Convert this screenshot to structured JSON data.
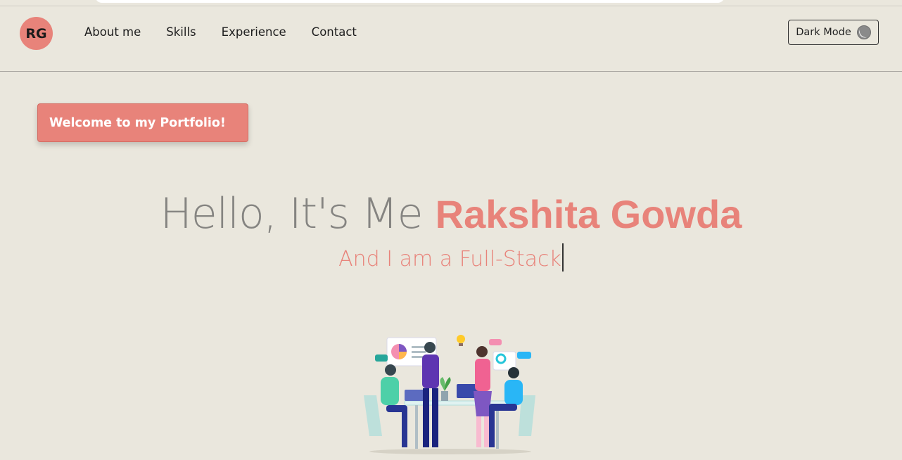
{
  "header": {
    "logo_text": "RG",
    "nav": [
      "About me",
      "Skills",
      "Experience",
      "Contact"
    ],
    "dark_mode_label": "Dark Mode"
  },
  "hero": {
    "badge": "Welcome to my Portfolio!",
    "greeting": "Hello, It's Me ",
    "name": "Rakshita Gowda",
    "subtitle": "And I am a Full-Stack"
  },
  "colors": {
    "background": "#eae7dd",
    "accent": "#e8837a",
    "text_muted": "#858481"
  },
  "icons": [
    "moon-icon"
  ],
  "illustration": "team-meeting-illustration"
}
